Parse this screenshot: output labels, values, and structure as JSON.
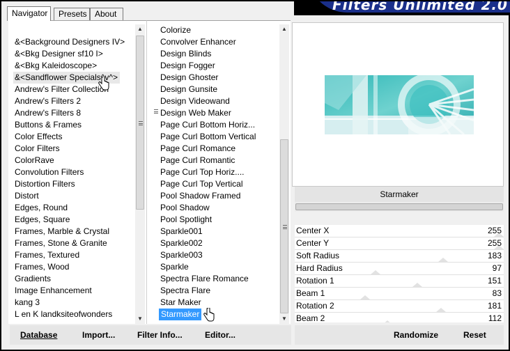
{
  "window": {
    "banner_title": "Filters Unlimited 2.0"
  },
  "tabs": [
    {
      "label": "Navigator",
      "active": true
    },
    {
      "label": "Presets",
      "active": false
    },
    {
      "label": "About",
      "active": false
    }
  ],
  "categories": [
    "&<Background Designers IV>",
    "&<Bkg Designer sf10 I>",
    "&<Bkg Kaleidoscope>",
    "&<Sandflower Specials^v^>",
    "Andrew's Filter Collection",
    "Andrew's Filters 2",
    "Andrew's Filters 8",
    "Buttons & Frames",
    "Color Effects",
    "Color Filters",
    "ColorRave",
    "Convolution Filters",
    "Distortion Filters",
    "Distort",
    "Edges, Round",
    "Edges, Square",
    "Frames, Marble & Crystal",
    "Frames, Stone & Granite",
    "Frames, Textured",
    "Frames, Wood",
    "Gradients",
    "Image Enhancement",
    "kang 3",
    "L en K landksiteofwonders"
  ],
  "categories_hovered": "&<Sandflower Specials^v^>",
  "filters": [
    "Colorize",
    "Convolver Enhancer",
    "Design Blinds",
    "Design Fogger",
    "Design Ghoster",
    "Design Gunsite",
    "Design Videowand",
    "Design Web Maker",
    "Page Curl Bottom Horiz...",
    "Page Curl Bottom Vertical",
    "Page Curl Romance",
    "Page Curl Romantic",
    "Page Curl Top Horiz....",
    "Page Curl Top Vertical",
    "Pool Shadow Framed",
    "Pool Shadow",
    "Pool Spotlight",
    "Sparkle001",
    "Sparkle002",
    "Sparkle003",
    "Sparkle",
    "Spectra Flare Romance",
    "Spectra Flare",
    "Star Maker",
    "Starmaker"
  ],
  "filters_selected": "Starmaker",
  "filter_name": "Starmaker",
  "params": [
    {
      "label": "Center X",
      "value": "255",
      "fraction": 1.0
    },
    {
      "label": "Center Y",
      "value": "255",
      "fraction": 1.0
    },
    {
      "label": "Soft Radius",
      "value": "183",
      "fraction": 0.72
    },
    {
      "label": "Hard Radius",
      "value": "97",
      "fraction": 0.38
    },
    {
      "label": "Rotation 1",
      "value": "151",
      "fraction": 0.59
    },
    {
      "label": "Beam 1",
      "value": "83",
      "fraction": 0.33
    },
    {
      "label": "Rotation 2",
      "value": "181",
      "fraction": 0.71
    },
    {
      "label": "Beam 2",
      "value": "112",
      "fraction": 0.44
    }
  ],
  "buttons": {
    "database": "Database",
    "import": "Import...",
    "filter_info": "Filter Info...",
    "editor": "Editor...",
    "randomize": "Randomize",
    "reset": "Reset"
  },
  "colors": {
    "selection": "#3399ff",
    "banner_blue": "#1a2f8a",
    "preview_teal": "#3fbfbf"
  }
}
